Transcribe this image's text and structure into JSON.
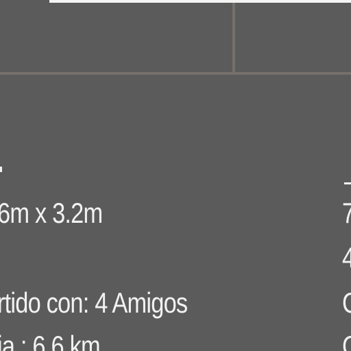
{
  "details": {
    "size": "6m x 3.2m",
    "shared": "rtido con:  4 Amigos",
    "distance": "ia : 6.6 km"
  },
  "right_column": [
    "7",
    "4",
    "C",
    "C"
  ]
}
